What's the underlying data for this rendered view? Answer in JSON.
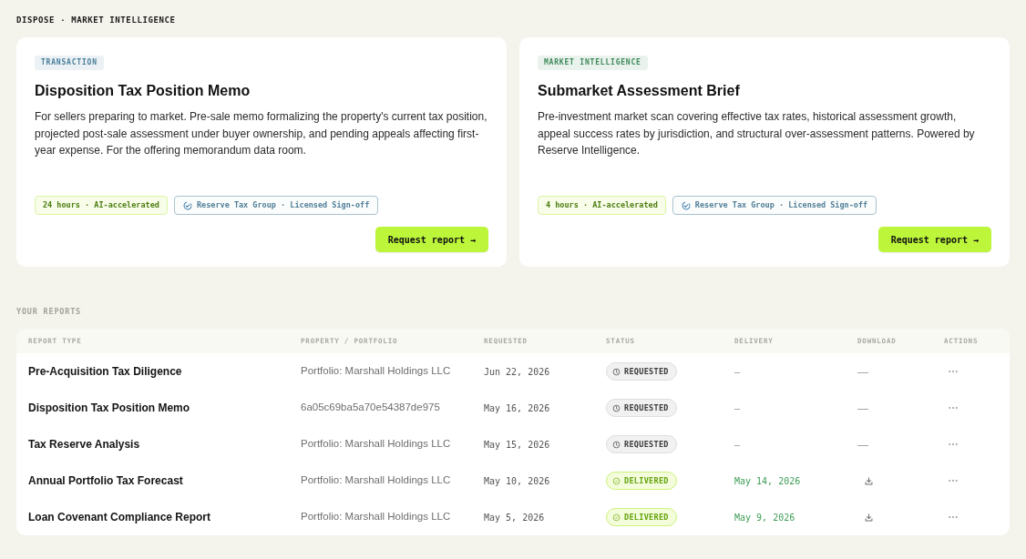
{
  "breadcrumb": "DISPOSE · MARKET INTELLIGENCE",
  "cards": [
    {
      "tag": {
        "label": "TRANSACTION",
        "color": "#4a7f9c"
      },
      "title": "Disposition Tax Position Memo",
      "description": "For sellers preparing to market. Pre-sale memo formalizing the property's current tax position, projected post-sale assessment under buyer ownership, and pending appeals affecting first-year expense. For the offering memorandum data room.",
      "chips": [
        {
          "kind": "turnaround",
          "label": "24 hours · AI-accelerated"
        },
        {
          "kind": "signoff",
          "label": "Reserve Tax Group · Licensed Sign-off"
        }
      ],
      "button": "Request report →"
    },
    {
      "tag": {
        "label": "MARKET INTELLIGENCE",
        "color": "#3f8a5c"
      },
      "title": "Submarket Assessment Brief",
      "description": "Pre-investment market scan covering effective tax rates, historical assessment growth, appeal success rates by jurisdiction, and structural over-assessment patterns. Powered by Reserve Intelligence.",
      "chips": [
        {
          "kind": "turnaround",
          "label": "4 hours · AI-accelerated"
        },
        {
          "kind": "signoff",
          "label": "Reserve Tax Group · Licensed Sign-off"
        }
      ],
      "button": "Request report →"
    }
  ],
  "reports": {
    "title": "YOUR REPORTS",
    "columns": [
      "REPORT TYPE",
      "PROPERTY / PORTFOLIO",
      "REQUESTED",
      "STATUS",
      "DELIVERY",
      "DOWNLOAD",
      "ACTIONS"
    ],
    "rows": [
      {
        "report_type": "Pre-Acquisition Tax Diligence",
        "property": "Portfolio: Marshall Holdings LLC",
        "requested": "Jun 22, 2026",
        "status": {
          "kind": "requested",
          "label": "REQUESTED"
        },
        "delivery": "–",
        "download": {
          "kind": "none",
          "text": "—"
        }
      },
      {
        "report_type": "Disposition Tax Position Memo",
        "property": "6a05c69ba5a70e54387de975",
        "requested": "May 16, 2026",
        "status": {
          "kind": "requested",
          "label": "REQUESTED"
        },
        "delivery": "–",
        "download": {
          "kind": "none",
          "text": "—"
        }
      },
      {
        "report_type": "Tax Reserve Analysis",
        "property": "Portfolio: Marshall Holdings LLC",
        "requested": "May 15, 2026",
        "status": {
          "kind": "requested",
          "label": "REQUESTED"
        },
        "delivery": "–",
        "download": {
          "kind": "none",
          "text": "—"
        }
      },
      {
        "report_type": "Annual Portfolio Tax Forecast",
        "property": "Portfolio: Marshall Holdings LLC",
        "requested": "May 10, 2026",
        "status": {
          "kind": "delivered",
          "label": "DELIVERED"
        },
        "delivery": "May 14, 2026",
        "download": {
          "kind": "file"
        }
      },
      {
        "report_type": "Loan Covenant Compliance Report",
        "property": "Portfolio: Marshall Holdings LLC",
        "requested": "May 5, 2026",
        "status": {
          "kind": "delivered",
          "label": "DELIVERED"
        },
        "delivery": "May 9, 2026",
        "download": {
          "kind": "file"
        }
      }
    ]
  }
}
